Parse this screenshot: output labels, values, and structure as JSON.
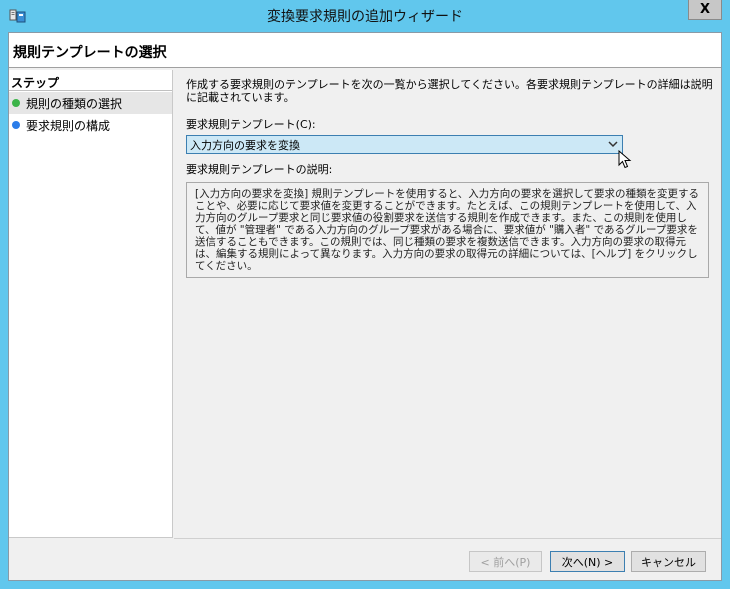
{
  "window": {
    "title": "変換要求規則の追加ウィザード",
    "close_label": "X"
  },
  "header": {
    "title": "規則テンプレートの選択"
  },
  "steps": {
    "title": "ステップ",
    "items": [
      {
        "label": "規則の種類の選択",
        "color": "#3cb449"
      },
      {
        "label": "要求規則の構成",
        "color": "#2b7de9"
      }
    ]
  },
  "main": {
    "intro": "作成する要求規則のテンプレートを次の一覧から選択してください。各要求規則テンプレートの詳細は説明に記載されています。",
    "template_label": "要求規則テンプレート(C):",
    "template_selected": "入力方向の要求を変換",
    "description_label": "要求規則テンプレートの説明:",
    "description": "[入力方向の要求を変換] 規則テンプレートを使用すると、入力方向の要求を選択して要求の種類を変更することや、必要に応じて要求値を変更することができます。たとえば、この規則テンプレートを使用して、入力方向のグループ要求と同じ要求値の役割要求を送信する規則を作成できます。また、この規則を使用して、値が \"管理者\" である入力方向のグループ要求がある場合に、要求値が \"購入者\" であるグループ要求を送信することもできます。この規則では、同じ種類の要求を複数送信できます。入力方向の要求の取得元は、編集する規則によって異なります。入力方向の要求の取得元の詳細については、[ヘルプ] をクリックしてください。"
  },
  "buttons": {
    "back": "< 前へ(P)",
    "next": "次へ(N) >",
    "cancel": "キャンセル"
  }
}
